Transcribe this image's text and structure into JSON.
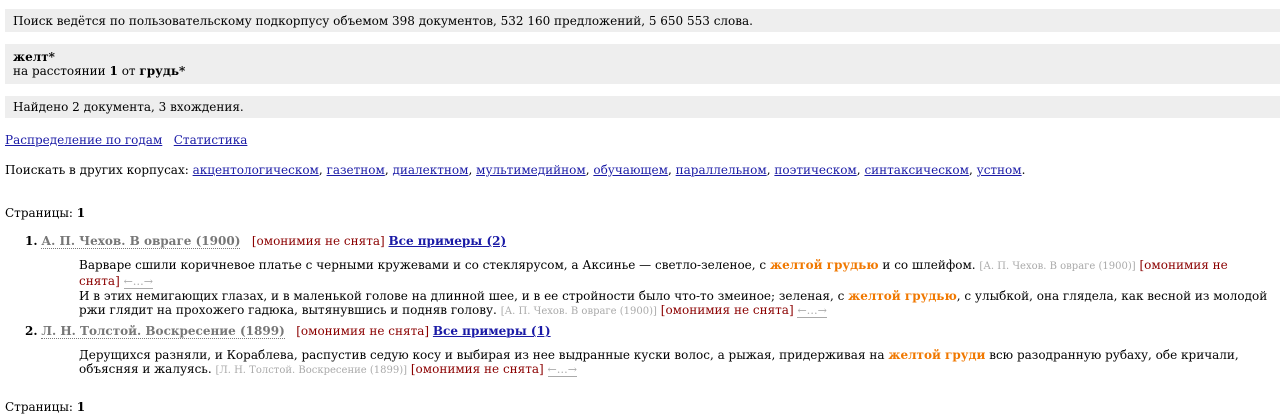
{
  "info": {
    "subcorpus": "Поиск ведётся по пользовательскому подкорпусу объемом 398 документов, 532 160 предложений, 5 650 553 слова."
  },
  "query": {
    "word1": "желт*",
    "distance_prefix": "на расстоянии",
    "distance": "1",
    "distance_from": "от",
    "word2": "грудь*"
  },
  "found": "Найдено 2 документа, 3 вхождения.",
  "links": {
    "years": "Распределение по годам",
    "stats": "Статистика"
  },
  "corpora": {
    "prefix": "Поискать в других корпусах:",
    "items": [
      "акцентологическом",
      "газетном",
      "диалектном",
      "мультимедийном",
      "обучающем",
      "параллельном",
      "поэтическом",
      "синтаксическом",
      "устном"
    ],
    "sep": ",",
    "end": "."
  },
  "pages": {
    "label": "Страницы:",
    "current": "1"
  },
  "omonymy": "[омонимия не снята]",
  "ctx_arrows": "←…→",
  "results": [
    {
      "num": "1.",
      "title": "А. П. Чехов. В овраге (1900)",
      "all": "Все примеры (2)",
      "s1_pre": "Варваре сшили коричневое платье с черными кружевами и со стеклярусом, а Аксинье — светло-зеленое, с ",
      "s1_hl": "желтой грудью",
      "s1_post": " и со шлейфом.",
      "s1_src": "[А. П. Чехов. В овраге (1900)]",
      "s2_pre": "И в этих немигающих глазах, и в маленькой голове на длинной шее, и в ее стройности было что-то змеиное; зеленая, с ",
      "s2_hl": "желтой грудью",
      "s2_post": ", с улыбкой, она глядела, как весной из молодой ржи глядит на прохожего гадюка, вытянувшись и подняв голову.",
      "s2_src": "[А. П. Чехов. В овраге (1900)]"
    },
    {
      "num": "2.",
      "title": "Л. Н. Толстой. Воскресение (1899)",
      "all": "Все примеры (1)",
      "s1_pre": "Дерущихся разняли, и Кораблева, распустив седую косу и выбирая из нее выдранные куски волос, а рыжая, придерживая на ",
      "s1_hl": "желтой груди",
      "s1_post": " всю разодранную рубаху, обе кричали, объясняя и жалуясь.",
      "s1_src": "[Л. Н. Толстой. Воскресение (1899)]"
    }
  ]
}
